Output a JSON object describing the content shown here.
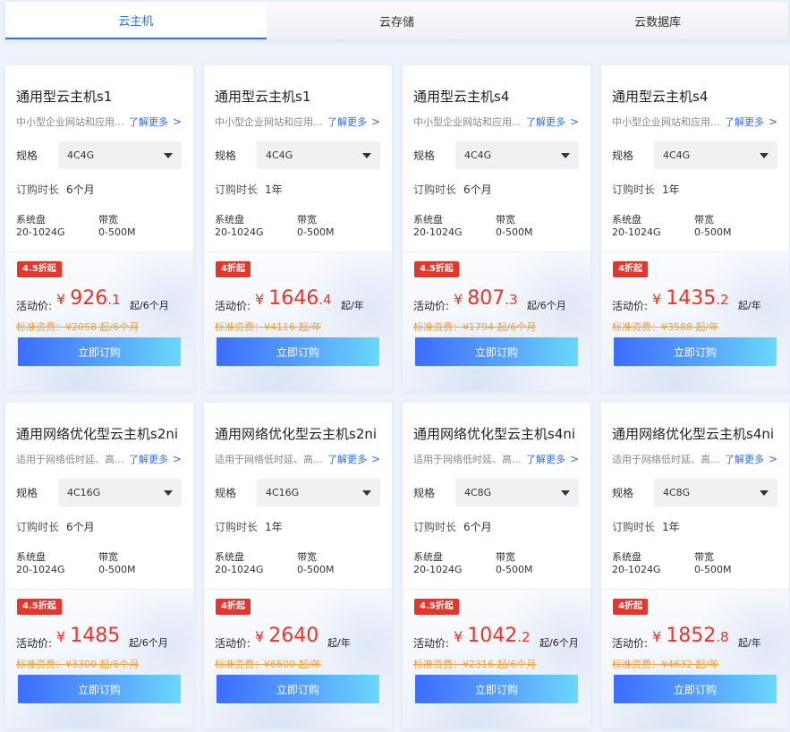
{
  "tabs": [
    {
      "label": "云主机",
      "active": true
    },
    {
      "label": "云存储",
      "active": false
    },
    {
      "label": "云数据库",
      "active": false
    }
  ],
  "common": {
    "spec_label": "规格",
    "duration_label": "订购时长",
    "disk_label": "系统盘",
    "disk_value": "20-1024G",
    "bandwidth_label": "带宽",
    "bandwidth_value": "0-500M",
    "promo_label": "活动价:",
    "buy_label": "立即订购",
    "more_label": "了解更多"
  },
  "accent_color": "#2e6ee6",
  "price_color": "#e8352b",
  "cards": [
    {
      "title": "通用型云主机s1",
      "desc": "中小型企业网站和应用...",
      "spec": "4C4G",
      "duration": "6个月",
      "badge": "4.5折起",
      "yen": "¥",
      "price_int": "926",
      "price_dec": ".1",
      "unit": "起/6个月",
      "standard": "标准资费：¥2058 起/6个月"
    },
    {
      "title": "通用型云主机s1",
      "desc": "中小型企业网站和应用...",
      "spec": "4C4G",
      "duration": "1年",
      "badge": "4折起",
      "yen": "¥",
      "price_int": "1646",
      "price_dec": ".4",
      "unit": "起/年",
      "standard": "标准资费：¥4116 起/年"
    },
    {
      "title": "通用型云主机s4",
      "desc": "中小型企业网站和应用...",
      "spec": "4C4G",
      "duration": "6个月",
      "badge": "4.5折起",
      "yen": "¥",
      "price_int": "807",
      "price_dec": ".3",
      "unit": "起/6个月",
      "standard": "标准资费：¥1794 起/6个月"
    },
    {
      "title": "通用型云主机s4",
      "desc": "中小型企业网站和应用...",
      "spec": "4C4G",
      "duration": "1年",
      "badge": "4折起",
      "yen": "¥",
      "price_int": "1435",
      "price_dec": ".2",
      "unit": "起/年",
      "standard": "标准资费：¥3588 起/年"
    },
    {
      "title": "通用网络优化型云主机s2ni",
      "desc": "适用于网络低时延、高...",
      "spec": "4C16G",
      "duration": "6个月",
      "badge": "4.5折起",
      "yen": "¥",
      "price_int": "1485",
      "price_dec": "",
      "unit": "起/6个月",
      "standard": "标准资费：¥3300 起/6个月"
    },
    {
      "title": "通用网络优化型云主机s2ni",
      "desc": "适用于网络低时延、高...",
      "spec": "4C16G",
      "duration": "1年",
      "badge": "4折起",
      "yen": "¥",
      "price_int": "2640",
      "price_dec": "",
      "unit": "起/年",
      "standard": "标准资费：¥6600 起/年"
    },
    {
      "title": "通用网络优化型云主机s4ni",
      "desc": "适用于网络低时延、高...",
      "spec": "4C8G",
      "duration": "6个月",
      "badge": "4.5折起",
      "yen": "¥",
      "price_int": "1042",
      "price_dec": ".2",
      "unit": "起/6个月",
      "standard": "标准资费：¥2316 起/6个月"
    },
    {
      "title": "通用网络优化型云主机s4ni",
      "desc": "适用于网络低时延、高...",
      "spec": "4C8G",
      "duration": "1年",
      "badge": "4折起",
      "yen": "¥",
      "price_int": "1852",
      "price_dec": ".8",
      "unit": "起/年",
      "standard": "标准资费：¥4632 起/年"
    }
  ]
}
